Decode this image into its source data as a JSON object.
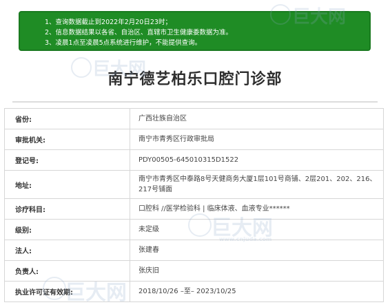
{
  "notice": {
    "lines": [
      "1、查询数据截止到2022年2月20日23时；",
      "2、信息数据结果以各省、自治区、直辖市卫生健康委数据为准。",
      "3、凌晨1点至凌晨5点系统进行维护，不能提供查询。"
    ]
  },
  "title": "南宁德艺柏乐口腔门诊部",
  "watermark": {
    "text": "巨大网",
    "url": "www.cnjuda.com"
  },
  "rows": [
    {
      "label": "省份:",
      "value": "广西壮族自治区"
    },
    {
      "label": "审批机关:",
      "value": "南宁市青秀区行政审批局"
    },
    {
      "label": "登记号:",
      "value": "PDY00505-645010315D1522"
    },
    {
      "label": "地址:",
      "value": "南宁市青秀区中泰路8号天健商务大厦1层101号商铺、2层201、202、216、217号铺面"
    },
    {
      "label": "诊疗科目:",
      "value": "口腔科 //医学检验科 | 临床体液、血液专业******"
    },
    {
      "label": "级别:",
      "value": "未定级"
    },
    {
      "label": "法人:",
      "value": "张建春"
    },
    {
      "label": "负责人:",
      "value": "张庆旧"
    },
    {
      "label": "执业许可证有效期:",
      "value": "2018/10/26 –至– 2023/10/25"
    }
  ]
}
